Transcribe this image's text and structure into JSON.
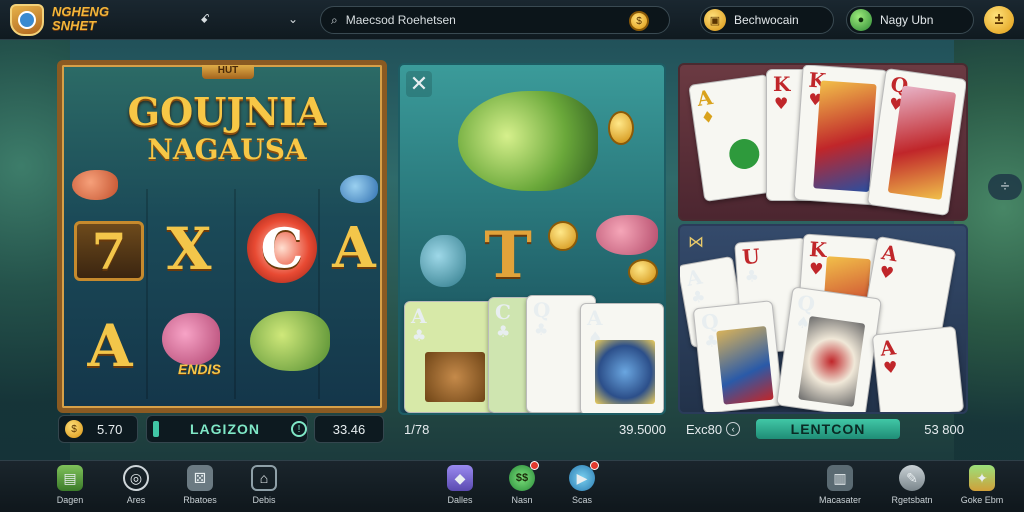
{
  "brand": {
    "name": "NGHENG SNHET"
  },
  "topbar": {
    "btn_left": "ꗃ",
    "btn_chevron": "⌄",
    "search_text": "Maecsod Roehetsen",
    "pill_1": "Bechwocain",
    "pill_2": "Nagy Ubn",
    "gold_symbol": "±"
  },
  "panels": {
    "slot": {
      "ribbon": "HUT",
      "title": "GOUJNIA",
      "subtitle": "NAGAUSA",
      "symbols": [
        "7",
        "X",
        "C",
        "A",
        "A"
      ],
      "fish_label": "ENDIS",
      "balance_coin": "$",
      "balance": "5.70",
      "bar_label": "LAGIZON",
      "bet": "33.46"
    },
    "fish": {
      "close_symbol": "✕",
      "big_symbol": "T",
      "left_value": "1/78",
      "right_value": "39.5000"
    },
    "cards_top": {},
    "cards_bottom": {
      "corner_symbol": "⋈",
      "left_value": "Exc80",
      "bar_label": "LENTCON",
      "right_value": "53 800"
    }
  },
  "cards": {
    "p2": [
      {
        "rank": "A",
        "suit": "♣"
      },
      {
        "rank": "C",
        "suit": "♣"
      },
      {
        "rank": "Q",
        "suit": "♣"
      },
      {
        "rank": "A",
        "suit": "♠"
      }
    ],
    "p3": [
      {
        "rank": "A",
        "suit": "♦"
      },
      {
        "rank": "K",
        "suit": "♥"
      },
      {
        "rank": "K",
        "suit": "♥"
      },
      {
        "rank": "Q",
        "suit": "♥"
      }
    ],
    "p4": [
      {
        "rank": "A",
        "suit": "♣"
      },
      {
        "rank": "U",
        "suit": "♣"
      },
      {
        "rank": "Q",
        "suit": "♣"
      },
      {
        "rank": "K",
        "suit": "♥"
      },
      {
        "rank": "A",
        "suit": "♥"
      },
      {
        "rank": "Q",
        "suit": "♠"
      },
      {
        "rank": "A",
        "suit": "♥"
      }
    ]
  },
  "nav": [
    {
      "label": "Dagen",
      "icon": "book-icon"
    },
    {
      "label": "Ares",
      "icon": "target-icon"
    },
    {
      "label": "Rbatoes",
      "icon": "dice-icon"
    },
    {
      "label": "Debis",
      "icon": "gift-icon"
    },
    {
      "label": "Dalles",
      "icon": "cube-icon"
    },
    {
      "label": "Nasn",
      "icon": "coin-icon"
    },
    {
      "label": "Scas",
      "icon": "play-icon"
    },
    {
      "label": "Macasater",
      "icon": "gear-icon"
    },
    {
      "label": "Rgetsbatn",
      "icon": "trophy-icon"
    },
    {
      "label": "Goke Ebm",
      "icon": "treasure-icon"
    }
  ],
  "colors": {
    "gold": "#f7c746",
    "accent_green": "#41c7a6",
    "topbar": "#101a20"
  }
}
